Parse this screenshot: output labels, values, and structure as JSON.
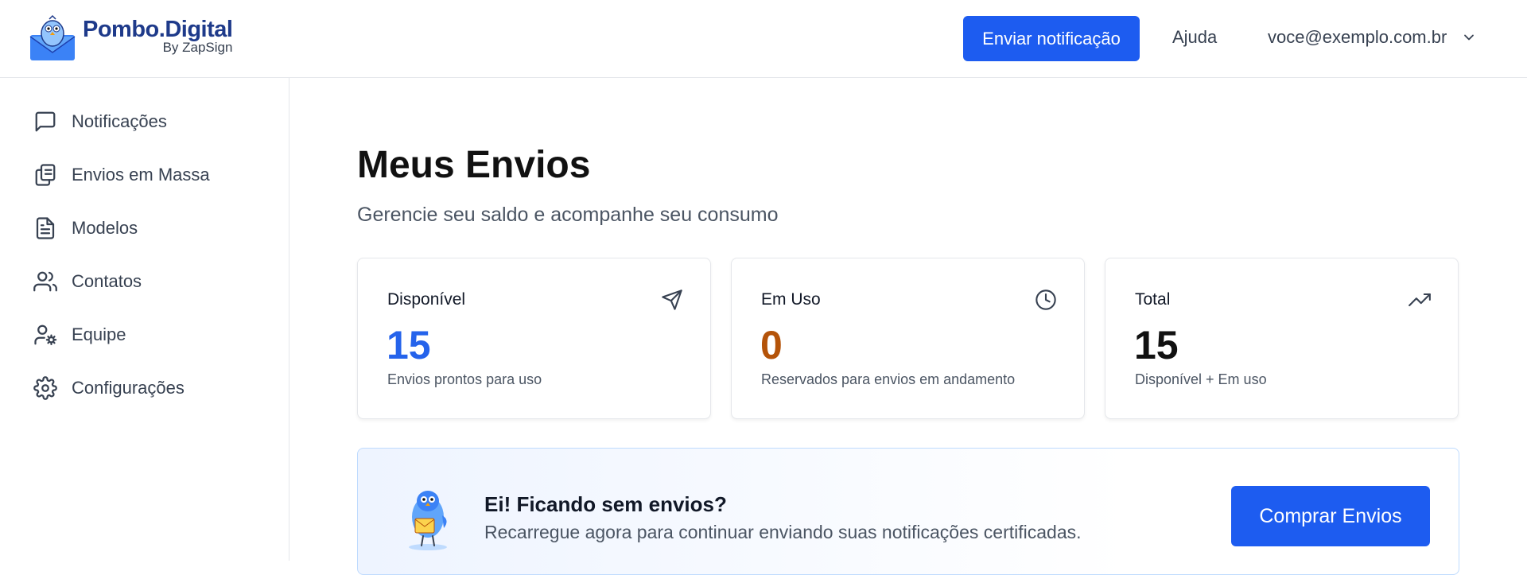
{
  "header": {
    "logo_title": "Pombo.Digital",
    "logo_sub": "By ZapSign",
    "send_button": "Enviar notificação",
    "help": "Ajuda",
    "user_email": "voce@exemplo.com.br"
  },
  "sidebar": {
    "items": [
      {
        "label": "Notificações",
        "icon": "message-square-icon"
      },
      {
        "label": "Envios em Massa",
        "icon": "copy-icon"
      },
      {
        "label": "Modelos",
        "icon": "file-text-icon"
      },
      {
        "label": "Contatos",
        "icon": "users-icon"
      },
      {
        "label": "Equipe",
        "icon": "user-cog-icon"
      },
      {
        "label": "Configurações",
        "icon": "gear-icon"
      }
    ]
  },
  "main": {
    "title": "Meus Envios",
    "subtitle": "Gerencie seu saldo e acompanhe seu consumo",
    "cards": [
      {
        "label": "Disponível",
        "value": "15",
        "desc": "Envios prontos para uso",
        "color": "#2563eb",
        "icon": "send-icon"
      },
      {
        "label": "Em Uso",
        "value": "0",
        "desc": "Reservados para envios em andamento",
        "color": "#b45309",
        "icon": "clock-icon"
      },
      {
        "label": "Total",
        "value": "15",
        "desc": "Disponível + Em uso",
        "color": "#111111",
        "icon": "trending-up-icon"
      }
    ],
    "banner": {
      "title": "Ei! Ficando sem envios?",
      "subtitle": "Recarregue agora para continuar enviando suas notificações certificadas.",
      "button": "Comprar Envios"
    }
  },
  "colors": {
    "accent": "#1d5cf0",
    "brand": "#1e3a8a"
  }
}
